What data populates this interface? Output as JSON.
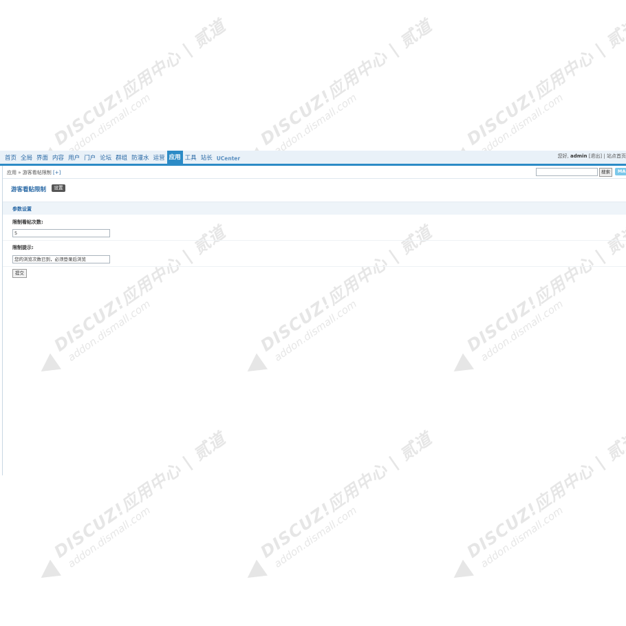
{
  "watermark": {
    "line1": "DISCUZ!应用中心 | 贰道",
    "line2": "addon.dismall.com"
  },
  "nav": {
    "items": [
      {
        "label": "首页"
      },
      {
        "label": "全局"
      },
      {
        "label": "界面"
      },
      {
        "label": "内容"
      },
      {
        "label": "用户"
      },
      {
        "label": "门户"
      },
      {
        "label": "论坛"
      },
      {
        "label": "群组"
      },
      {
        "label": "防灌水"
      },
      {
        "label": "运营"
      },
      {
        "label": "应用",
        "active": true
      },
      {
        "label": "工具"
      },
      {
        "label": "站长"
      },
      {
        "label": "UCenter"
      }
    ]
  },
  "user": {
    "greeting": "您好,",
    "name": "admin",
    "logout": "[退出]",
    "site_home": "站点首页"
  },
  "breadcrumb": {
    "text": "应用 » 游客看帖限制",
    "add": "[+]"
  },
  "search": {
    "button": "搜索",
    "map": "MAP"
  },
  "page": {
    "title": "游客看贴限制",
    "setting_button": "设置"
  },
  "section": {
    "title": "参数设置"
  },
  "fields": {
    "limit_count_label": "限制看帖次数:",
    "limit_count_value": "5",
    "tip_label": "限制提示:",
    "tip_value": "您的浏览次数已到，必须登录后浏览"
  },
  "form": {
    "submit": "提交"
  }
}
